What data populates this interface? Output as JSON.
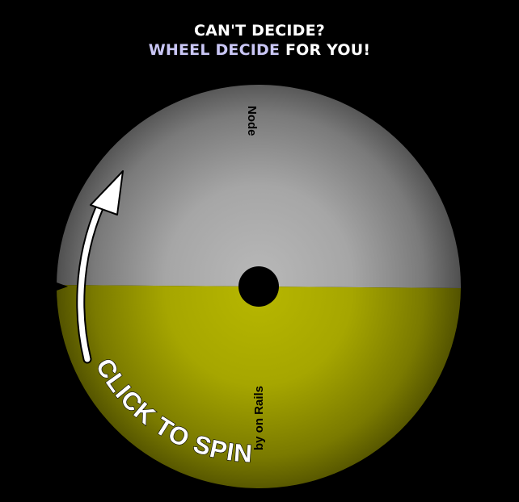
{
  "heading": {
    "line1": "CAN'T DECIDE?",
    "accent": "WHEEL DECIDE",
    "line2_rest": " FOR YOU!"
  },
  "wheel": {
    "segments": [
      {
        "label": "Node",
        "color": "#b4b4b4"
      },
      {
        "label": "Ruby on Rails",
        "visible_label": "by on Rails",
        "color": "#b3b300"
      }
    ],
    "hub_color": "#000000"
  },
  "spin": {
    "label": "CLICK TO SPIN",
    "color": "#ffffff"
  }
}
